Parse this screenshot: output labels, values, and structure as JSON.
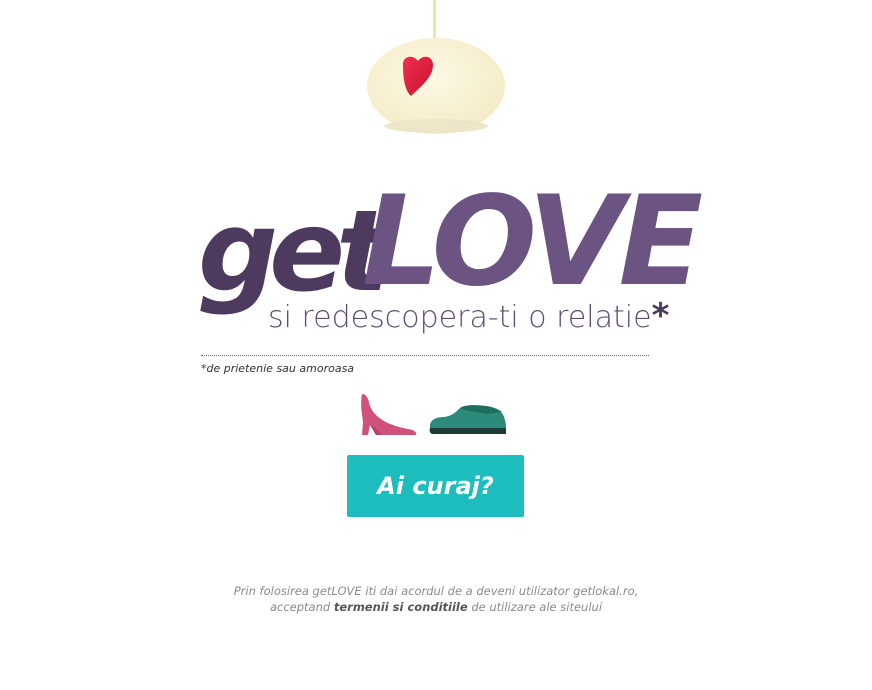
{
  "logo": {
    "part1": "get",
    "part2": "LOVE"
  },
  "tagline": {
    "text": "si redescopera-ti o relatie",
    "asterisk": "*"
  },
  "footnote": "*de prietenie sau amoroasa",
  "cta": {
    "label": "Ai curaj?"
  },
  "legal": {
    "line1": "Prin folosirea getLOVE iti dai acordul de a deveni utilizator getlokal.ro,",
    "line2_prefix": "acceptand ",
    "terms_link": "termenii si conditiile",
    "line2_suffix": " de utilizare ale siteului"
  },
  "colors": {
    "brand_dark": "#4d3a5e",
    "brand_light": "#6b5482",
    "accent": "#1dbdbd",
    "heart": "#e8234a"
  }
}
